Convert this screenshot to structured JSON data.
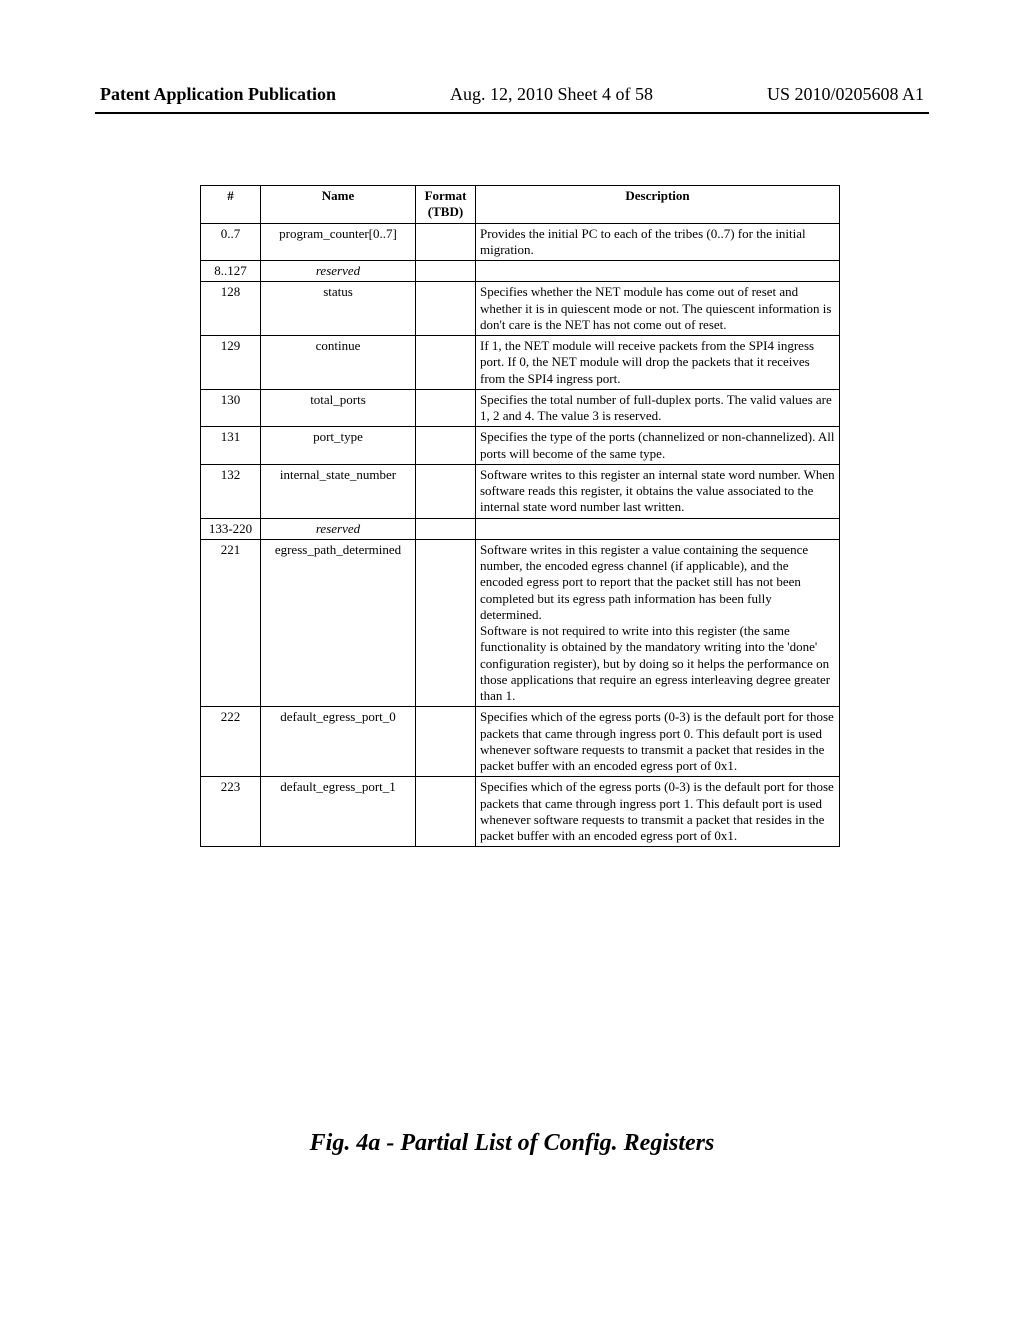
{
  "header": {
    "left": "Patent Application Publication",
    "mid": "Aug. 12, 2010  Sheet 4 of 58",
    "right": "US 2010/0205608 A1"
  },
  "table": {
    "headers": {
      "c1": "#",
      "c2": "Name",
      "c3": "Format (TBD)",
      "c4": "Description"
    },
    "rows": [
      {
        "num": "0..7",
        "name": "program_counter[0..7]",
        "fmt": "",
        "desc": "Provides the initial PC to each of the tribes (0..7) for the initial migration."
      },
      {
        "num": "8..127",
        "name": "reserved",
        "italic": true,
        "fmt": "",
        "desc": ""
      },
      {
        "num": "128",
        "name": "status",
        "fmt": "",
        "desc": "Specifies whether the NET module has come out of reset and whether it is in quiescent mode or not. The quiescent information is don't care is the NET has not come out of reset."
      },
      {
        "num": "129",
        "name": "continue",
        "fmt": "",
        "desc": "If 1, the NET module will receive packets from the SPI4 ingress port. If 0, the NET module will drop the packets that it receives from the SPI4 ingress port."
      },
      {
        "num": "130",
        "name": "total_ports",
        "fmt": "",
        "desc": "Specifies the total number of full-duplex ports. The valid values are 1, 2 and 4. The value 3 is reserved."
      },
      {
        "num": "131",
        "name": "port_type",
        "fmt": "",
        "desc": "Specifies the type of the ports (channelized or non-channelized). All ports will become of the same type."
      },
      {
        "num": "132",
        "name": "internal_state_number",
        "fmt": "",
        "desc": "Software writes to this register an internal state word number. When software reads this register, it obtains the value associated to the internal state word number last written."
      },
      {
        "num": "133-220",
        "name": "reserved",
        "italic": true,
        "fmt": "",
        "desc": ""
      },
      {
        "num": "221",
        "name": "egress_path_determined",
        "fmt": "",
        "desc": "Software writes in this register a value containing the sequence number, the encoded egress channel (if applicable), and the encoded egress port to report that the packet still has not been completed but its egress path information has been fully determined.\nSoftware is not required to write into this register (the same functionality is obtained by the mandatory writing into the 'done' configuration register), but by doing so it helps the performance on those applications that require an egress interleaving degree greater than 1."
      },
      {
        "num": "222",
        "name": "default_egress_port_0",
        "fmt": "",
        "desc": "Specifies which of the egress ports (0-3) is the default port for those packets that came through ingress port 0. This default port is used whenever software requests to transmit a packet that resides in the packet buffer with an encoded egress port of 0x1."
      },
      {
        "num": "223",
        "name": "default_egress_port_1",
        "fmt": "",
        "desc": "Specifies which of the egress ports (0-3) is the default port for those packets that came through ingress port 1. This default port is used whenever software requests to transmit a packet that resides in the packet buffer with an encoded egress port of 0x1."
      }
    ]
  },
  "caption": "Fig. 4a - Partial List of Config. Registers"
}
